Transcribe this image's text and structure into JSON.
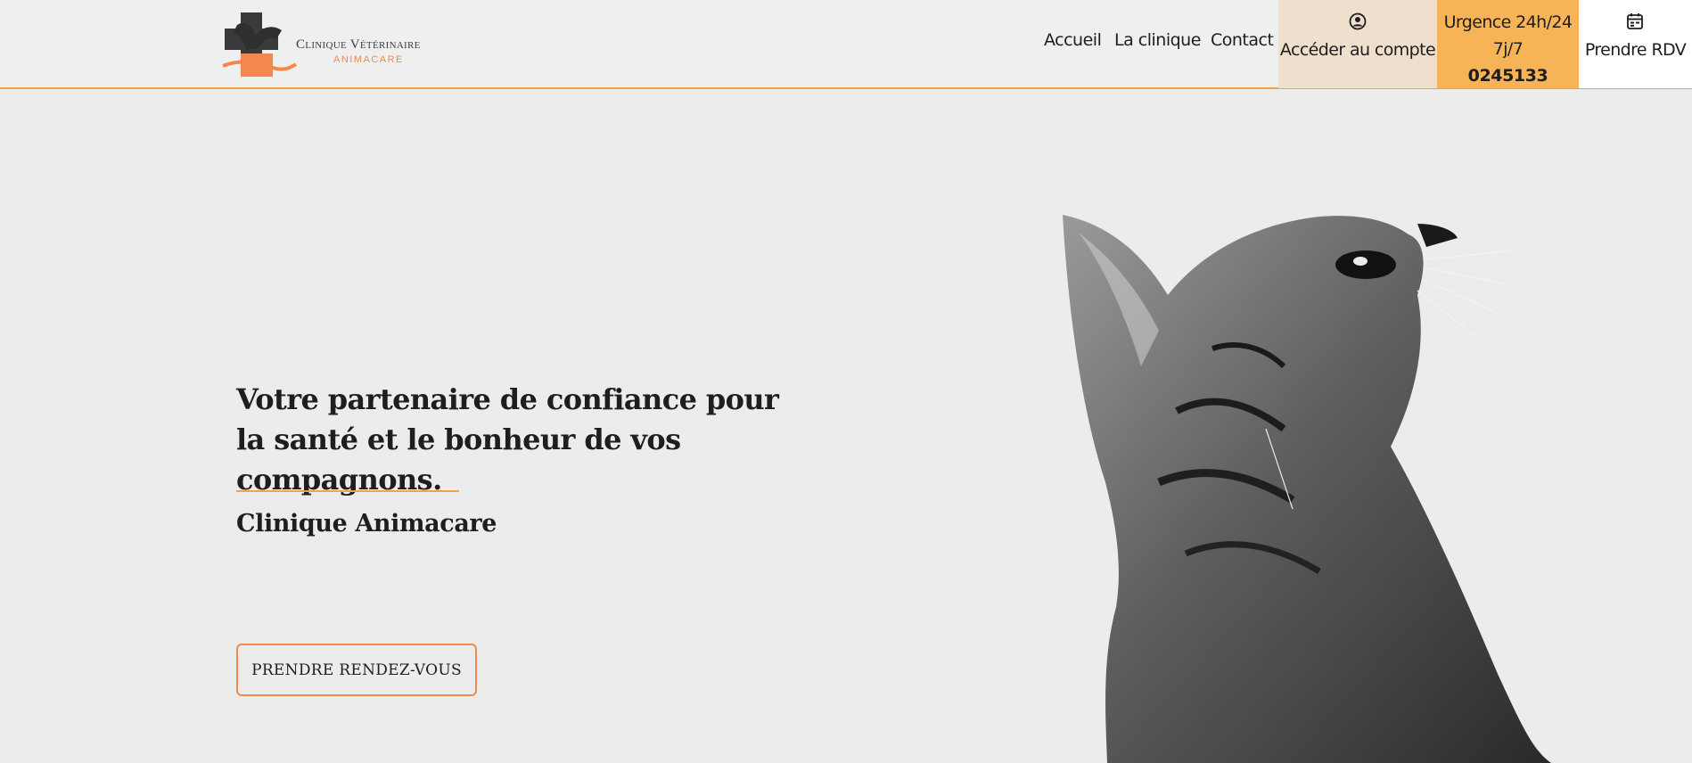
{
  "header": {
    "logo": {
      "name": "Clinique Vétérinaire",
      "sub": "ANIMACARE"
    },
    "nav": [
      "Accueil",
      "La clinique",
      "Contact"
    ],
    "account": {
      "icon": "user-circle-icon",
      "label": "Accéder au compte"
    },
    "emergency": {
      "line1": "Urgence 24h/24",
      "line2": "7j/7",
      "phone": "0245133"
    },
    "appointment": {
      "icon": "calendar-icon",
      "label": "Prendre RDV"
    }
  },
  "hero": {
    "headline": "Votre partenaire de confiance pour la santé et le bonheur de vos compagnons.",
    "subtitle": "Clinique Animacare",
    "cta": "PRENDRE RENDEZ-VOUS",
    "image": "cat-looking-up-photo"
  },
  "colors": {
    "accent_orange": "#f2a24a",
    "emergency_bg": "#f6b456",
    "account_bg": "#efdfcd",
    "button_border": "#ee8a4f",
    "logo_dark": "#3a3a3a",
    "logo_orange": "#f08a4b"
  }
}
